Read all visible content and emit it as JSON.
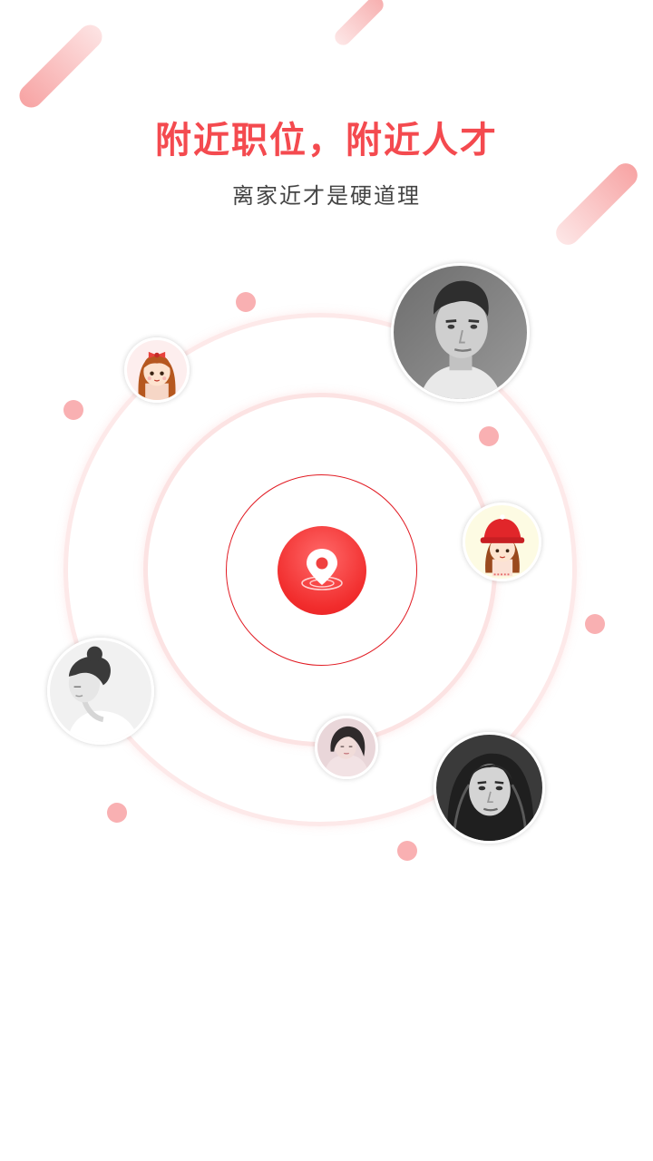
{
  "hero": {
    "title": "附近职位，附近人才",
    "subtitle": "离家近才是硬道理"
  },
  "colors": {
    "accent": "#f44a4f",
    "ring_inner": "#e11a22",
    "dot": "#f9b0b2"
  },
  "locate_button": {
    "icon": "map-pin-icon"
  },
  "avatars": [
    {
      "name": "avatar-cartoon-girl-bow",
      "style": "cartoon"
    },
    {
      "name": "avatar-man-photo",
      "style": "photo"
    },
    {
      "name": "avatar-cartoon-girl-red-hat",
      "style": "cartoon"
    },
    {
      "name": "avatar-woman-side-profile",
      "style": "photo"
    },
    {
      "name": "avatar-woman-small",
      "style": "photo"
    },
    {
      "name": "avatar-woman-long-hair",
      "style": "photo"
    }
  ]
}
